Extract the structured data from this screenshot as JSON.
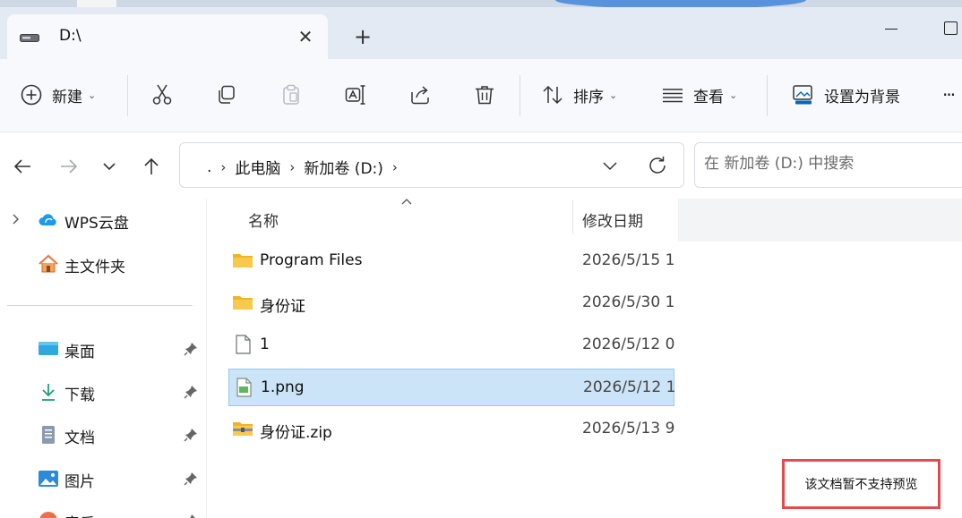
{
  "tab": {
    "title": "D:\\",
    "close_glyph": "✕",
    "new_tab_glyph": "+"
  },
  "toolbar": {
    "new_label": "新建",
    "sort_label": "排序",
    "view_label": "查看",
    "set_background_label": "设置为背景",
    "more_label": "···"
  },
  "address": {
    "crumbs": [
      ".",
      "此电脑",
      "新加卷 (D:)"
    ],
    "separator": "›"
  },
  "search": {
    "placeholder": "在 新加卷 (D:) 中搜索"
  },
  "sidebar": {
    "items": [
      {
        "label": "WPS云盘",
        "icon": "wps-cloud-icon"
      },
      {
        "label": "主文件夹",
        "icon": "home-icon"
      },
      {
        "label": "桌面",
        "icon": "desktop-icon"
      },
      {
        "label": "下载",
        "icon": "download-icon"
      },
      {
        "label": "文档",
        "icon": "document-icon"
      },
      {
        "label": "图片",
        "icon": "pictures-icon"
      },
      {
        "label": "音乐",
        "icon": "music-icon"
      }
    ]
  },
  "columns": {
    "name": "名称",
    "modified": "修改日期"
  },
  "files": [
    {
      "name": "Program Files",
      "date": "2026/5/15 1",
      "type": "folder"
    },
    {
      "name": "身份证",
      "date": "2026/5/30 1",
      "type": "folder"
    },
    {
      "name": "1",
      "date": "2026/5/12 0",
      "type": "file"
    },
    {
      "name": "1.png",
      "date": "2026/5/12 1",
      "type": "image",
      "selected": true
    },
    {
      "name": "身份证.zip",
      "date": "2026/5/13 9",
      "type": "zip"
    }
  ],
  "preview": {
    "message": "该文档暂不支持预览"
  },
  "colors": {
    "accent": "#0067c0",
    "selection": "#cce4f7",
    "highlight_border": "#e5494d",
    "folder": "#f8c94a"
  }
}
